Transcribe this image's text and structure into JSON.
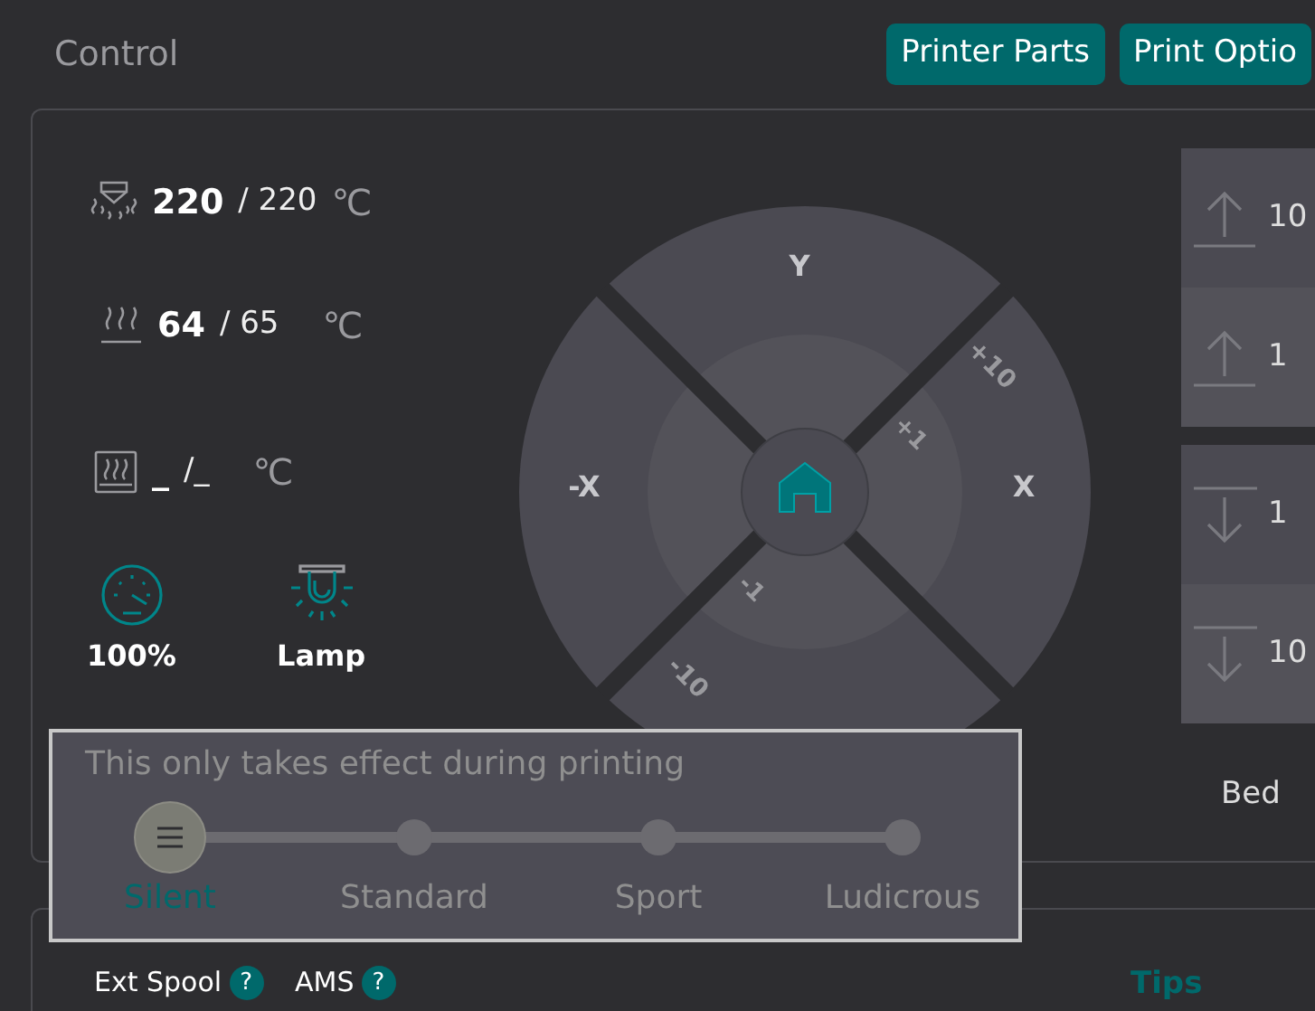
{
  "header": {
    "title": "Control",
    "buttons": [
      "Printer Parts",
      "Print Optio"
    ]
  },
  "temperatures": [
    {
      "kind": "nozzle",
      "current": "220",
      "target": "/ 220",
      "unit": "℃"
    },
    {
      "kind": "bed",
      "current": "64",
      "target": "/ 65",
      "unit": "℃"
    },
    {
      "kind": "chamber",
      "current": "_",
      "target": "/_",
      "unit": "℃"
    }
  ],
  "controls": [
    {
      "kind": "speed",
      "label": "100%"
    },
    {
      "kind": "lamp",
      "label": "Lamp"
    }
  ],
  "jog_pad": {
    "y_plus": "Y",
    "x_minus": "-X",
    "x_plus": "X",
    "outer_plus": "+10",
    "inner_plus": "+1",
    "inner_minus": "-1",
    "outer_minus": "-10"
  },
  "z_buttons": [
    {
      "kind": "up",
      "step": "10"
    },
    {
      "kind": "up",
      "step": "1"
    },
    {
      "kind": "down",
      "step": "1"
    },
    {
      "kind": "down",
      "step": "10"
    }
  ],
  "z_label": "Bed",
  "speed_popup": {
    "hint": "This only takes effect during printing",
    "levels": [
      {
        "label": "Silent",
        "selected": true
      },
      {
        "label": "Standard",
        "selected": false
      },
      {
        "label": "Sport",
        "selected": false
      },
      {
        "label": "Ludicrous",
        "selected": false
      }
    ]
  },
  "bottom": {
    "items": [
      {
        "label": "Ext Spool",
        "help": "?"
      },
      {
        "label": "AMS",
        "help": "?"
      }
    ],
    "tips": "Tips"
  }
}
